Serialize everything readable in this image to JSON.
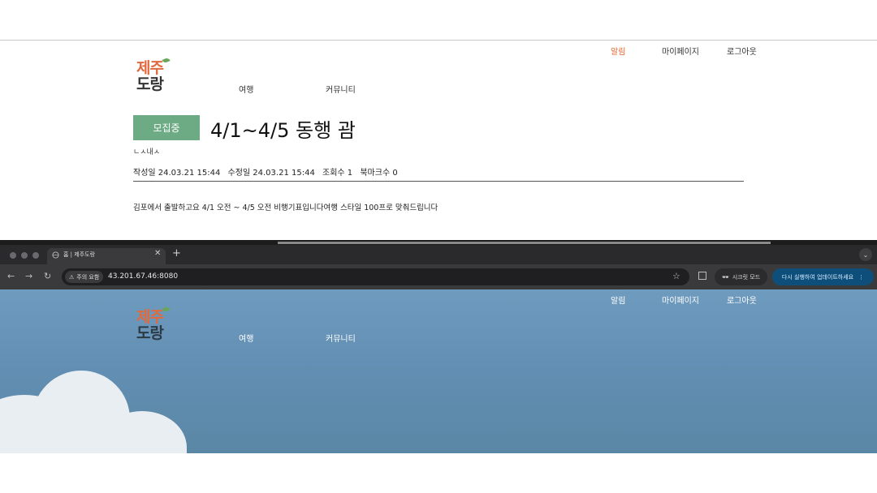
{
  "top_page": {
    "utility_nav": [
      "알림",
      "마이페이지",
      "로그아웃"
    ],
    "logo": {
      "line1": "제주",
      "line2": "도랑"
    },
    "main_nav": [
      "여행",
      "커뮤니티"
    ],
    "post": {
      "status": "모집중",
      "title": "4/1~4/5 동행 괌",
      "author": "ㄴㅅ내ㅅ",
      "meta": {
        "created": "작성일 24.03.21 15:44",
        "modified": "수정일 24.03.21 15:44",
        "views": "조회수 1",
        "bookmarks": "북마크수 0"
      },
      "body": "김포에서 출발하고요 4/1 오전 ~ 4/5 오전 비행기표입니다여행 스타일 100프로 맞춰드립니다"
    }
  },
  "browser": {
    "tab_title": "홈 | 제주도랑",
    "new_tab": "+",
    "security_label": "주의 요함",
    "url": "43.201.67.46:8080",
    "incognito_label": "시크릿 모드",
    "update_label": "다시 실행하여 업데이트하세요",
    "accent_color": "#0d4f7a"
  },
  "bottom_page": {
    "utility_nav": [
      "알림",
      "마이페이지",
      "로그아웃"
    ],
    "logo": {
      "line1": "제주",
      "line2": "도랑"
    },
    "main_nav": [
      "여행",
      "커뮤니티"
    ]
  }
}
